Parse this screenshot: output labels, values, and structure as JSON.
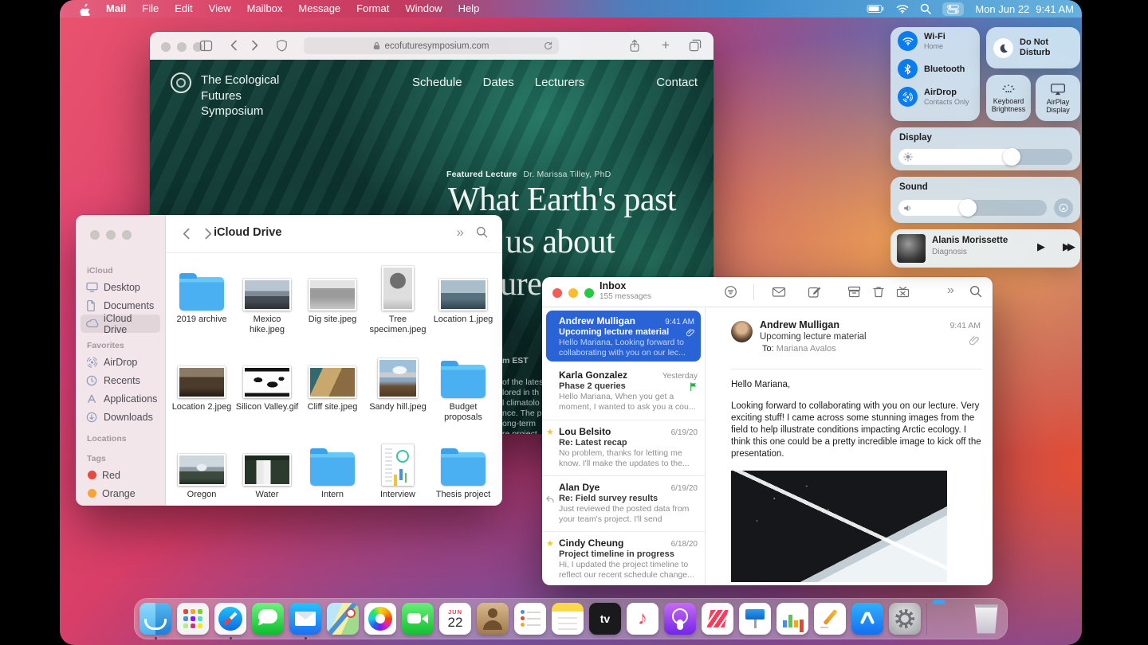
{
  "menu_bar": {
    "app_menus": [
      "Mail",
      "File",
      "Edit",
      "View",
      "Mailbox",
      "Message",
      "Format",
      "Window",
      "Help"
    ],
    "date": "Mon Jun 22",
    "time": "9:41 AM"
  },
  "safari": {
    "url": "ecofuturesymposium.com",
    "site_name_line1": "The Ecological",
    "site_name_line2": "Futures Symposium",
    "nav": [
      "Schedule",
      "Dates",
      "Lecturers",
      "Contact"
    ],
    "featured_label": "Featured Lecture",
    "featured_speaker": "Dr. Marissa Tilley, PhD",
    "headline_line1": "What Earth's past",
    "headline_line2": "us about",
    "headline_line3": "ture →",
    "fragment_time": "m EST",
    "fragment_lines": [
      "of the lates",
      "lored in th",
      "l climatolo",
      "nce. The p",
      "ong-term",
      "re project"
    ]
  },
  "finder": {
    "title": "iCloud Drive",
    "sidebar": {
      "sections": {
        "icloud": "iCloud",
        "favorites": "Favorites",
        "locations": "Locations",
        "tags": "Tags"
      },
      "icloud_items": [
        "Desktop",
        "Documents",
        "iCloud Drive"
      ],
      "selected_item": "iCloud Drive",
      "favorites_items": [
        "AirDrop",
        "Recents",
        "Applications",
        "Downloads"
      ],
      "tags": [
        {
          "label": "Red",
          "color": "#e5493f"
        },
        {
          "label": "Orange",
          "color": "#f7a23b"
        }
      ]
    },
    "files": [
      {
        "name": "2019 archive",
        "kind": "folder"
      },
      {
        "name": "Mexico hike.jpeg",
        "kind": "image"
      },
      {
        "name": "Dig site.jpeg",
        "kind": "image"
      },
      {
        "name": "Tree specimen.jpeg",
        "kind": "image"
      },
      {
        "name": "Location 1.jpeg",
        "kind": "image"
      },
      {
        "name": "Location 2.jpeg",
        "kind": "image"
      },
      {
        "name": "Silicon Valley.gif",
        "kind": "image"
      },
      {
        "name": "Cliff site.jpeg",
        "kind": "image"
      },
      {
        "name": "Sandy hill.jpeg",
        "kind": "image"
      },
      {
        "name": "Budget proposals",
        "kind": "folder"
      },
      {
        "name": "Oregon",
        "kind": "image"
      },
      {
        "name": "Water",
        "kind": "image"
      },
      {
        "name": "Intern",
        "kind": "folder"
      },
      {
        "name": "Interview",
        "kind": "document"
      },
      {
        "name": "Thesis project",
        "kind": "folder"
      }
    ]
  },
  "mail": {
    "window_title": "Inbox",
    "message_count": "155 messages",
    "messages": [
      {
        "sender": "Andrew Mulligan",
        "date": "9:41 AM",
        "subject": "Upcoming lecture material",
        "preview": "Hello Mariana, Looking forward to collaborating with you on our lec...",
        "marker": "paperclip",
        "selected": true
      },
      {
        "sender": "Karla Gonzalez",
        "date": "Yesterday",
        "subject": "Phase 2 queries",
        "preview": "Hello Mariana, When you get a moment, I wanted to ask you a cou...",
        "marker": "flag",
        "selected": false
      },
      {
        "sender": "Lou Belsito",
        "date": "6/19/20",
        "subject": "Re: Latest recap",
        "preview": "No problem, thanks for letting me know. I'll make the updates to the...",
        "marker": "star",
        "selected": false
      },
      {
        "sender": "Alan Dye",
        "date": "6/19/20",
        "subject": "Re: Field survey results",
        "preview": "Just reviewed the posted data from your team's project. I'll send through...",
        "marker": "reply",
        "selected": false
      },
      {
        "sender": "Cindy Cheung",
        "date": "6/18/20",
        "subject": "Project timeline in progress",
        "preview": "Hi, I updated the project timeline to reflect our recent schedule change...",
        "marker": "star",
        "selected": false
      }
    ],
    "reading": {
      "sender": "Andrew Mulligan",
      "time": "9:41 AM",
      "subject": "Upcoming lecture material",
      "to_label": "To:",
      "recipient": "Mariana Avalos",
      "greeting": "Hello Mariana,",
      "body": "Looking forward to collaborating with you on our lecture. Very exciting stuff! I came across some stunning images from the field to help illustrate conditions impacting Arctic ecology. I think this one could be a pretty incredible image to kick off the presentation."
    }
  },
  "control_center": {
    "wifi_label": "Wi-Fi",
    "wifi_status": "Home",
    "bluetooth_label": "Bluetooth",
    "airdrop_label": "AirDrop",
    "airdrop_status": "Contacts Only",
    "dnd_label": "Do Not Disturb",
    "keyboard_label": "Keyboard Brightness",
    "airplay_label": "AirPlay Display",
    "display_label": "Display",
    "display_level_pct": 65,
    "sound_label": "Sound",
    "sound_level_pct": 47,
    "now_playing": {
      "artist": "Alanis Morissette",
      "track": "Diagnosis"
    },
    "glyphs": {
      "play": "▶",
      "forward": "▶▶"
    }
  },
  "dock": {
    "apps": [
      "finder",
      "launchpad",
      "safari",
      "messages",
      "mail",
      "maps",
      "photos",
      "facetime",
      "calendar",
      "contacts",
      "reminders",
      "notes",
      "tv",
      "music",
      "podcasts",
      "news",
      "keynote",
      "numbers",
      "pages",
      "app-store",
      "system-preferences",
      "downloads-folder",
      "trash"
    ],
    "running_apps": [
      "finder",
      "safari",
      "mail"
    ],
    "calendar_month": "JUN",
    "calendar_day": "22",
    "tv_label": "tv",
    "music_glyph": "♪"
  },
  "colors": {
    "accent_blue": "#0a7cf0",
    "selected_mail_bg": "#2a63d6",
    "folder_blue": "#4bb0f2",
    "flag_green": "#23b24b",
    "star_yellow": "#f5c531",
    "menubar_left_pink": "#e4607f",
    "menubar_right_blue": "#67b0dd"
  }
}
